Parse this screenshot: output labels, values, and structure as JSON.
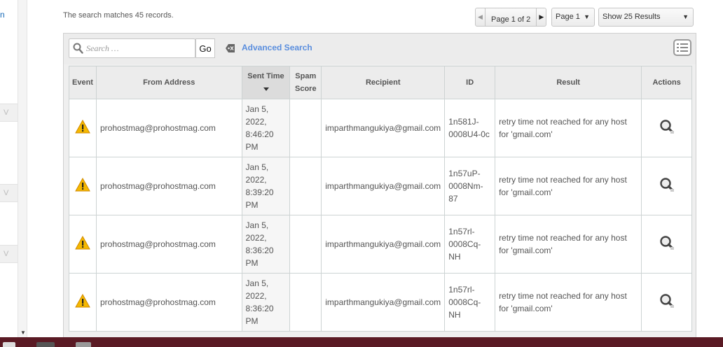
{
  "sidebar": {
    "fragment_text": "n",
    "chevron": "V"
  },
  "summary": "The search matches 45 records.",
  "pager": {
    "prev": "◀",
    "label": "Page 1 of 2",
    "next": "▶"
  },
  "page_select": {
    "value": "Page 1"
  },
  "results_select": {
    "value": "Show 25 Results"
  },
  "toolbar": {
    "search_placeholder": "Search …",
    "go_label": "Go",
    "advanced_search": "Advanced Search"
  },
  "table": {
    "headers": {
      "event": "Event",
      "from": "From Address",
      "sent": "Sent Time",
      "spam": "Spam Score",
      "recipient": "Recipient",
      "id": "ID",
      "result": "Result",
      "actions": "Actions"
    },
    "rows": [
      {
        "from": "prohostmag@prohostmag.com",
        "sent": "Jan 5, 2022, 8:46:20 PM",
        "spam": "",
        "recipient": "imparthmangukiya@gmail.com",
        "id": "1n581J-0008U4-0c",
        "result": "retry time not reached for any host for 'gmail.com'"
      },
      {
        "from": "prohostmag@prohostmag.com",
        "sent": "Jan 5, 2022, 8:39:20 PM",
        "spam": "",
        "recipient": "imparthmangukiya@gmail.com",
        "id": "1n57uP-0008Nm-87",
        "result": "retry time not reached for any host for 'gmail.com'"
      },
      {
        "from": "prohostmag@prohostmag.com",
        "sent": "Jan 5, 2022, 8:36:20 PM",
        "spam": "",
        "recipient": "imparthmangukiya@gmail.com",
        "id": "1n57rl-0008Cq-NH",
        "result": "retry time not reached for any host for 'gmail.com'"
      },
      {
        "from": "prohostmag@prohostmag.com",
        "sent": "Jan 5, 2022, 8:36:20 PM",
        "spam": "",
        "recipient": "imparthmangukiya@gmail.com",
        "id": "1n57rl-0008Cq-NH",
        "result": "retry time not reached for any host for 'gmail.com'"
      }
    ]
  },
  "colors": {
    "link": "#5a8ede",
    "warning": "#f5b800",
    "taskbar": "#5a1a24"
  },
  "icons": {
    "event": "warning-icon",
    "action": "magnifier-icon",
    "search": "search-icon",
    "advanced": "tag-icon",
    "menu": "list-menu-icon"
  }
}
